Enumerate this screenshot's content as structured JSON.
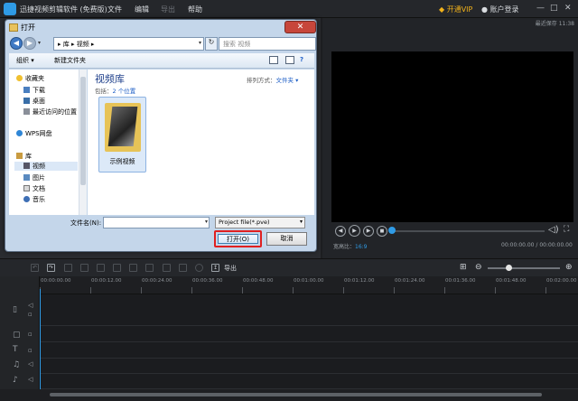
{
  "app": {
    "title": "迅捷视频剪辑软件 (免费版)",
    "menu": [
      "文件",
      "编辑",
      "导出",
      "帮助"
    ],
    "disabled_menu": "导出",
    "vip": "开通VIP",
    "login": "账户登录",
    "time": "11:38",
    "window_controls": [
      "—",
      "□",
      "✕"
    ]
  },
  "preview": {
    "saved_label": "最近保存 11:38",
    "ratio_label": "宽高比：",
    "ratio_value": "16:9",
    "timecode": "00:00:00.00 / 00:00:00.00"
  },
  "dialog": {
    "title": "打开",
    "close": "✕",
    "address": "▸ 库 ▸ 视频 ▸",
    "search_placeholder": "搜索 视频",
    "toolbar": {
      "organize": "组织 ▾",
      "new_folder": "新建文件夹"
    },
    "nav": {
      "favorites": "收藏夹",
      "downloads": "下载",
      "desktop": "桌面",
      "recent": "最近访问的位置",
      "wps": "WPS网盘",
      "libraries": "库",
      "videos": "视频",
      "pictures": "图片",
      "documents": "文档",
      "music": "音乐"
    },
    "library": {
      "title": "视频库",
      "includes": "包括：",
      "locations": "2 个位置",
      "arrange_label": "排列方式：",
      "arrange_value": "文件夹 ▾"
    },
    "folder_item": "示例视频",
    "filename_label": "文件名(N):",
    "filename_value": "",
    "filetype": "Project file(*.pve)",
    "open_button": "打开(O)",
    "cancel_button": "取消"
  },
  "timeline": {
    "export_label": "导出",
    "ruler": [
      "00:00:00.00",
      "00:00:12.00",
      "00:00:24.00",
      "00:00:36.00",
      "00:00:48.00",
      "00:01:00.00",
      "00:01:12.00",
      "00:01:24.00",
      "00:01:36.00",
      "00:01:48.00",
      "00:02:00.00"
    ]
  },
  "colors": {
    "accent": "#2f9be6",
    "highlight_box": "#e02020",
    "vip": "#f2b21a"
  }
}
